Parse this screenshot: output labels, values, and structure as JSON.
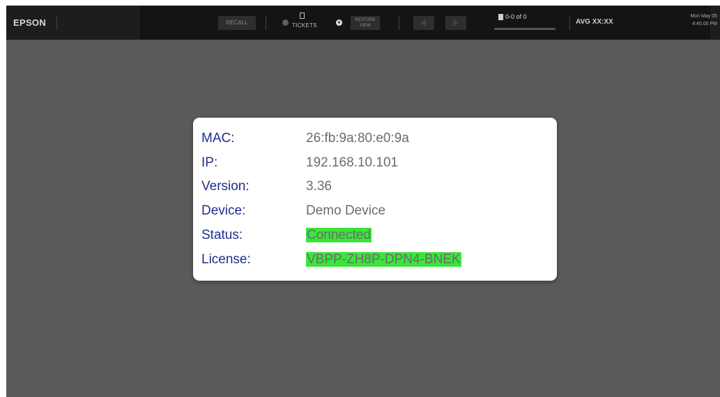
{
  "topbar": {
    "logo": "EPSON",
    "recall_label": "RECALL",
    "tickets_label": "TICKETS",
    "restore_label": "RESTORE VIEW",
    "pager_text": "0-0 of 0",
    "avg_label": "AVG XX:XX",
    "clock_date": "Mon May 05",
    "clock_time": "4:45:00 PM"
  },
  "device_info": {
    "rows": [
      {
        "label": "MAC:",
        "value": "26:fb:9a:80:e0:9a"
      },
      {
        "label": "IP:",
        "value": "192.168.10.101"
      },
      {
        "label": "Version:",
        "value": "3.36"
      },
      {
        "label": "Device:",
        "value": "Demo Device"
      },
      {
        "label": "Status:",
        "value": "Connected"
      },
      {
        "label": "License:",
        "value": "VBPP-ZH8P-DPN4-BNEK"
      }
    ]
  },
  "colors": {
    "label_color": "#1f2f8e",
    "highlight_color": "#39e639",
    "background": "#5a5a5a",
    "topbar": "#1d1d1d"
  }
}
